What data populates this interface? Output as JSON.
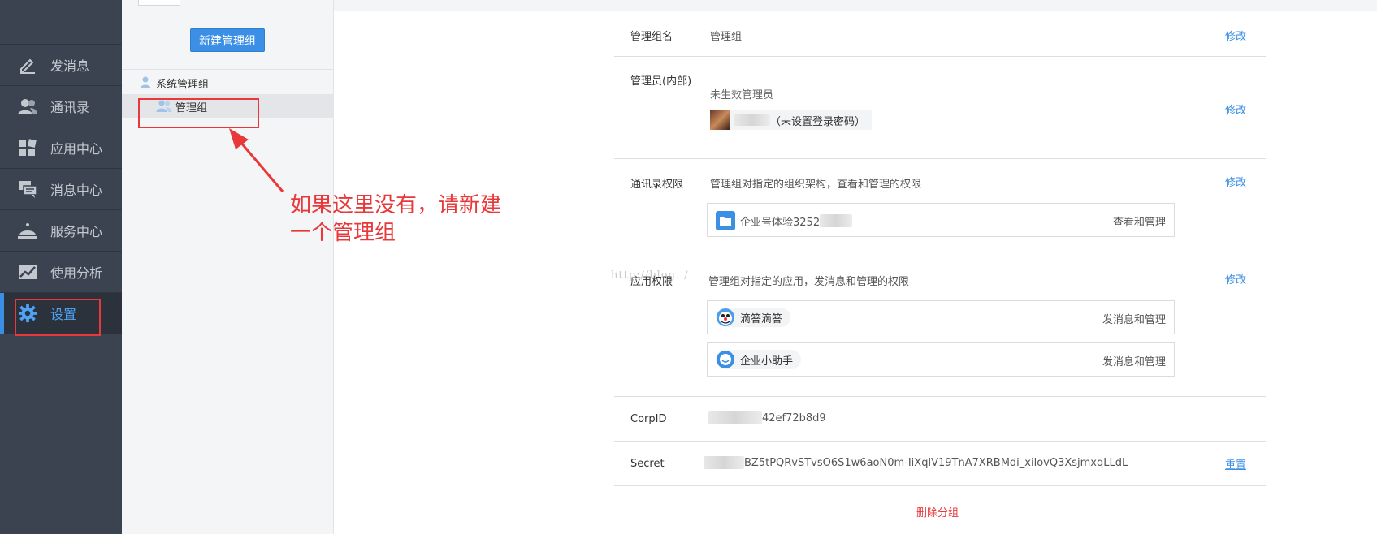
{
  "nav": {
    "items": [
      {
        "label": "发消息",
        "icon": "pencil-icon"
      },
      {
        "label": "通讯录",
        "icon": "contacts-icon"
      },
      {
        "label": "应用中心",
        "icon": "apps-grid-icon"
      },
      {
        "label": "消息中心",
        "icon": "message-bubbles-icon"
      },
      {
        "label": "服务中心",
        "icon": "service-bell-icon"
      },
      {
        "label": "使用分析",
        "icon": "analytics-chart-icon"
      },
      {
        "label": "设置",
        "icon": "gear-icon",
        "active": true
      }
    ]
  },
  "sidebar": {
    "new_group_button": "新建管理组",
    "system_group": "系统管理组",
    "group": "管理组"
  },
  "annotation": {
    "line1": "如果这里没有，请新建",
    "line2": "一个管理组"
  },
  "watermark": "http://blog.    /",
  "detail": {
    "group_name": {
      "label": "管理组名",
      "value": "管理组",
      "action": "修改"
    },
    "admins": {
      "label": "管理员(内部)",
      "status": "未生效管理员",
      "admin_note": "（未设置登录密码）",
      "action": "修改"
    },
    "contacts_perm": {
      "label": "通讯录权限",
      "desc": "管理组对指定的组织架构，查看和管理的权限",
      "action": "修改",
      "org_name": "企业号体验3252",
      "org_right": "查看和管理"
    },
    "app_perm": {
      "label": "应用权限",
      "desc": "管理组对指定的应用，发消息和管理的权限",
      "action": "修改",
      "apps": [
        {
          "name": "滴答滴答",
          "right": "发消息和管理",
          "icon": "dida-app-icon"
        },
        {
          "name": "企业小助手",
          "right": "发消息和管理",
          "icon": "assistant-app-icon"
        }
      ]
    },
    "corpid": {
      "label": "CorpID",
      "value": "42ef72b8d9"
    },
    "secret": {
      "label": "Secret",
      "value": "BZ5tPQRvSTvsO6S1w6aoN0m-IiXqlV19TnA7XRBMdi_xilovQ3XsjmxqLLdL",
      "action": "重置"
    },
    "delete_link": "删除分组"
  },
  "colors": {
    "nav_bg": "#3b4350",
    "accent": "#3b8fe5",
    "annotation": "#e8383a"
  }
}
